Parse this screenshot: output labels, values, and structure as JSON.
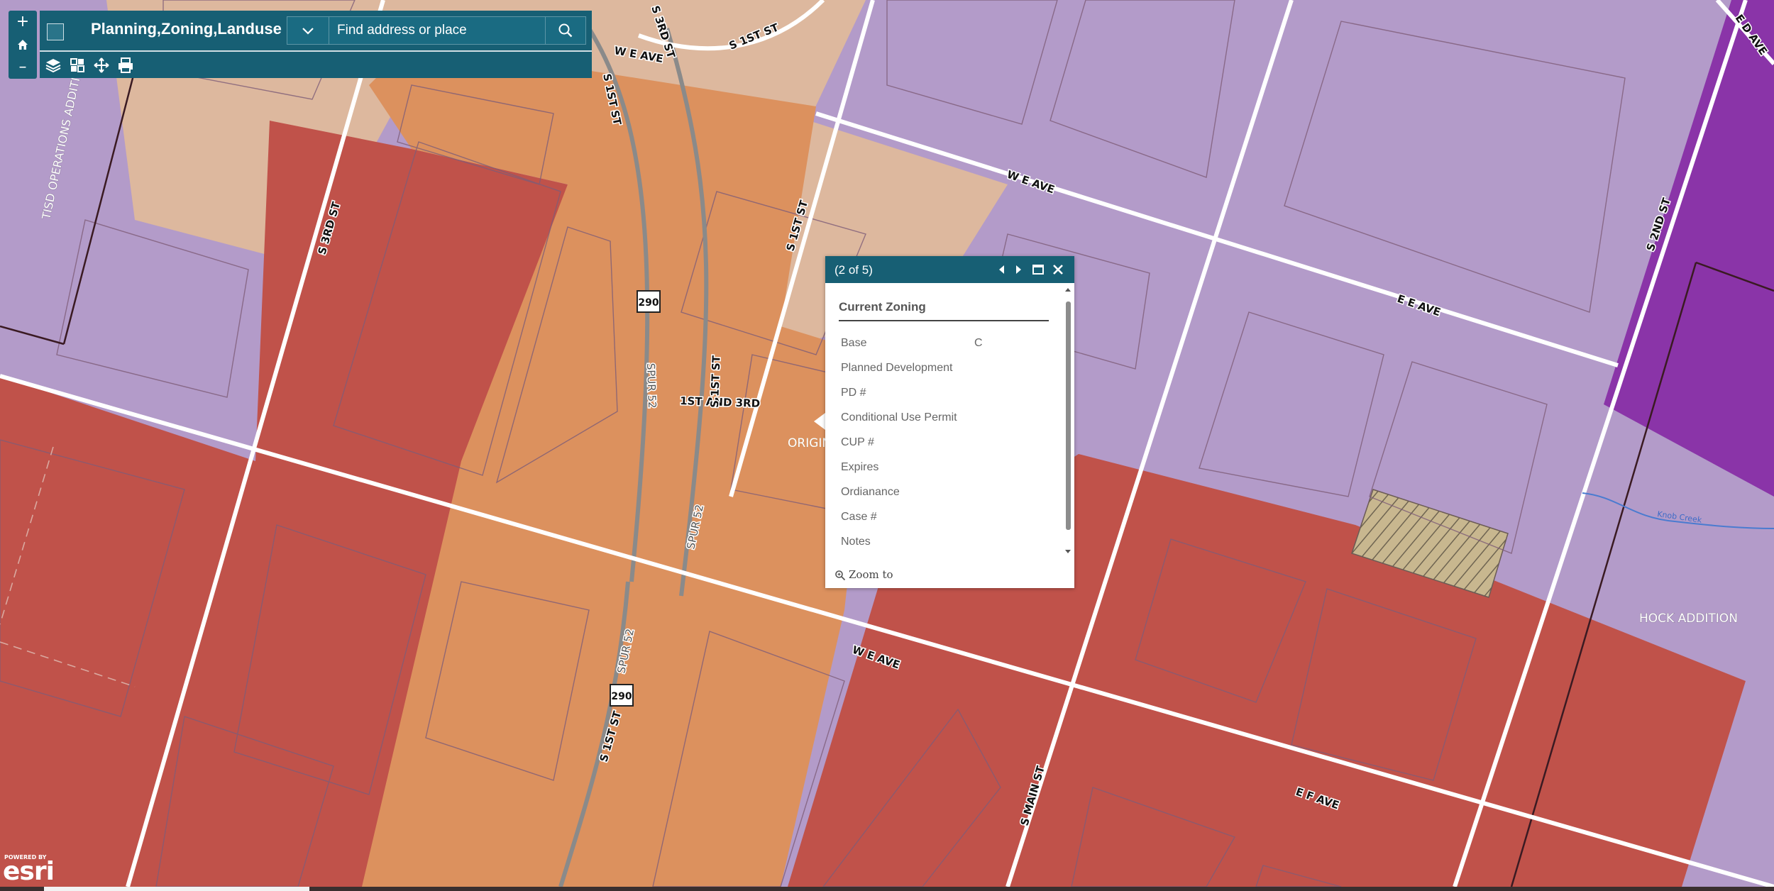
{
  "app": {
    "title": "Planning,Zoning,Landuse",
    "search_placeholder": "Find address or place"
  },
  "zoom_control": {
    "zoom_in": "+",
    "zoom_out": "–"
  },
  "toolbar": [
    "layers-icon",
    "basemap-gallery-icon",
    "measure-icon",
    "print-icon"
  ],
  "popup": {
    "count": "(2 of 5)",
    "section_title": "Current Zoning",
    "attributes": [
      {
        "label": "Base",
        "value": "C"
      },
      {
        "label": "Planned Development",
        "value": ""
      },
      {
        "label": "PD #",
        "value": ""
      },
      {
        "label": "Conditional Use Permit",
        "value": ""
      },
      {
        "label": "CUP #",
        "value": ""
      },
      {
        "label": "Expires",
        "value": ""
      },
      {
        "label": "Ordianance",
        "value": ""
      },
      {
        "label": "Case #",
        "value": ""
      },
      {
        "label": "Notes",
        "value": ""
      }
    ],
    "zoom_to": "Zoom to"
  },
  "map": {
    "colors": {
      "purple": "#b39bc9",
      "dark_purple": "#8a34a8",
      "red": "#c0524a",
      "orange": "#dc915e",
      "tan": "#ddb89e",
      "hatched": "#c8b78f"
    },
    "street_labels": [
      "S 3RD ST",
      "W E AVE",
      "S 1ST ST",
      "S 1ST ST",
      "S 3RD ST",
      "W E AVE",
      "S 1ST ST",
      "E E AVE",
      "S 2ND ST",
      "E D AVE",
      "1ST AND 3RD",
      "S 1ST ST",
      "SPUR 52",
      "SPUR 52",
      "SPUR 52",
      "W E AVE",
      "S 1ST ST",
      "S MAIN ST",
      "E F AVE"
    ],
    "area_labels": [
      "TISD OPERATIONS ADDITION",
      "ORIGIN",
      "HOCK ADDITION",
      "Knob Creek"
    ],
    "route_shields": [
      "290",
      "290"
    ],
    "attribution": "POWERED BY",
    "brand": "esri"
  }
}
